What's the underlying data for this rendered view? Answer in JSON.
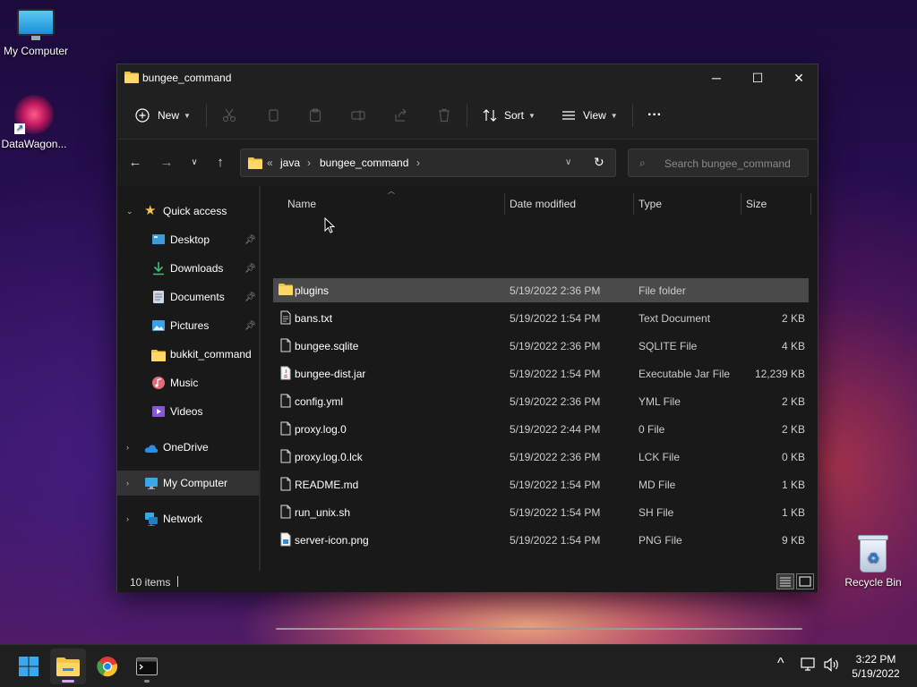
{
  "desktop": {
    "icons": [
      {
        "label": "My Computer"
      },
      {
        "label": "DataWagon..."
      },
      {
        "label": "Recycle Bin"
      }
    ]
  },
  "window": {
    "title": "bungee_command",
    "controls": {
      "minimize": "─",
      "maximize": "☐",
      "close": "✕"
    }
  },
  "toolbar": {
    "new_label": "New",
    "sort_label": "Sort",
    "view_label": "View",
    "more_label": "···",
    "icons": [
      "cut-icon",
      "copy-icon",
      "paste-icon",
      "rename-icon",
      "share-icon",
      "delete-icon"
    ]
  },
  "address": {
    "overflow": "«",
    "crumbs": [
      "java",
      "bungee_command"
    ],
    "search_placeholder": "Search bungee_command"
  },
  "nav": {
    "quick_access": "Quick access",
    "items": [
      {
        "label": "Desktop",
        "pinned": true,
        "icon": "desktop-icon"
      },
      {
        "label": "Downloads",
        "pinned": true,
        "icon": "downloads-icon"
      },
      {
        "label": "Documents",
        "pinned": true,
        "icon": "documents-icon"
      },
      {
        "label": "Pictures",
        "pinned": true,
        "icon": "pictures-icon"
      },
      {
        "label": "bukkit_command",
        "pinned": false,
        "icon": "folder-icon"
      },
      {
        "label": "Music",
        "pinned": false,
        "icon": "music-icon"
      },
      {
        "label": "Videos",
        "pinned": false,
        "icon": "videos-icon"
      }
    ],
    "onedrive": "OneDrive",
    "my_computer": "My Computer",
    "network": "Network"
  },
  "columns": {
    "name": "Name",
    "date": "Date modified",
    "type": "Type",
    "size": "Size"
  },
  "files": [
    {
      "name": "plugins",
      "date": "5/19/2022 2:36 PM",
      "type": "File folder",
      "size": "",
      "icon": "folder-icon"
    },
    {
      "name": "bans.txt",
      "date": "5/19/2022 1:54 PM",
      "type": "Text Document",
      "size": "2 KB",
      "icon": "text-file-icon"
    },
    {
      "name": "bungee.sqlite",
      "date": "5/19/2022 2:36 PM",
      "type": "SQLITE File",
      "size": "4 KB",
      "icon": "file-icon"
    },
    {
      "name": "bungee-dist.jar",
      "date": "5/19/2022 1:54 PM",
      "type": "Executable Jar File",
      "size": "12,239 KB",
      "icon": "java-icon"
    },
    {
      "name": "config.yml",
      "date": "5/19/2022 2:36 PM",
      "type": "YML File",
      "size": "2 KB",
      "icon": "file-icon"
    },
    {
      "name": "proxy.log.0",
      "date": "5/19/2022 2:44 PM",
      "type": "0 File",
      "size": "2 KB",
      "icon": "file-icon"
    },
    {
      "name": "proxy.log.0.lck",
      "date": "5/19/2022 2:36 PM",
      "type": "LCK File",
      "size": "0 KB",
      "icon": "file-icon"
    },
    {
      "name": "README.md",
      "date": "5/19/2022 1:54 PM",
      "type": "MD File",
      "size": "1 KB",
      "icon": "file-icon"
    },
    {
      "name": "run_unix.sh",
      "date": "5/19/2022 1:54 PM",
      "type": "SH File",
      "size": "1 KB",
      "icon": "file-icon"
    },
    {
      "name": "server-icon.png",
      "date": "5/19/2022 1:54 PM",
      "type": "PNG File",
      "size": "9 KB",
      "icon": "image-file-icon"
    }
  ],
  "status": {
    "count": "10 items"
  },
  "taskbar": {
    "apps": [
      "start-icon",
      "file-explorer-icon",
      "chrome-icon",
      "terminal-icon"
    ],
    "tray_overflow": "^",
    "time": "3:22 PM",
    "date": "5/19/2022"
  },
  "colors": {
    "folder": "#f4c542",
    "accent": "#0078d4",
    "selected_row": "#4a4a4a"
  }
}
